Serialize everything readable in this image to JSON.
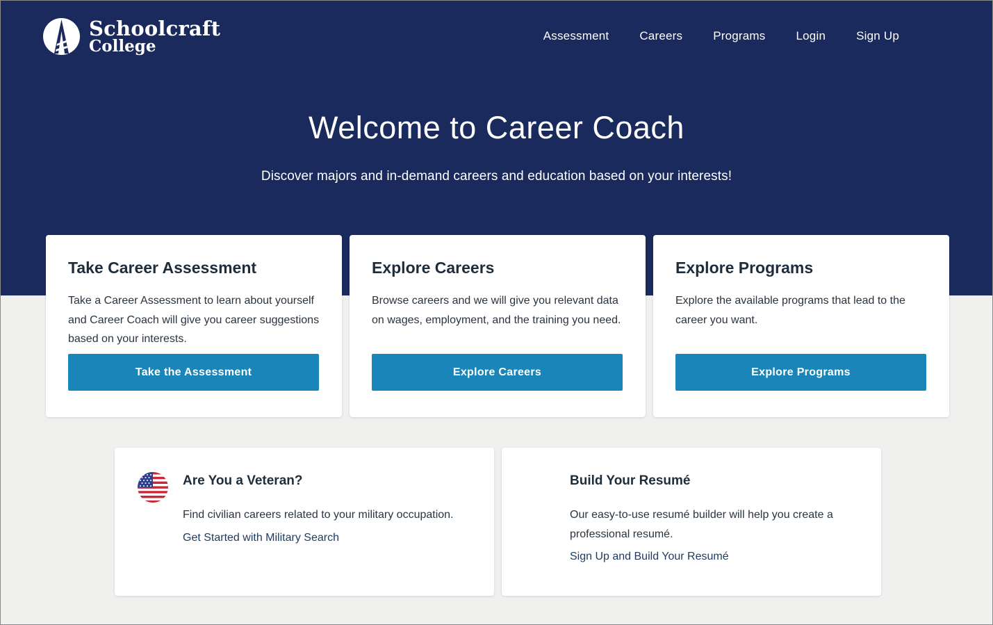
{
  "header": {
    "logo_line1": "Schoolcraft",
    "logo_line2": "College",
    "nav": [
      "Assessment",
      "Careers",
      "Programs",
      "Login",
      "Sign Up"
    ]
  },
  "hero": {
    "title": "Welcome to Career Coach",
    "subtitle": "Discover majors and in-demand careers and education based on your interests!"
  },
  "cards": [
    {
      "title": "Take Career Assessment",
      "text": "Take a Career Assessment to learn about yourself and Career Coach will give you career suggestions based on your interests.",
      "button": "Take the Assessment"
    },
    {
      "title": "Explore Careers",
      "text": "Browse careers and we will give you relevant data on wages, employment, and the training you need.",
      "button": "Explore Careers"
    },
    {
      "title": "Explore Programs",
      "text": "Explore the available programs that lead to the career you want.",
      "button": "Explore Programs"
    }
  ],
  "veteran": {
    "title": "Are You a Veteran?",
    "text": "Find civilian careers related to your military occupation.",
    "link": "Get Started with Military Search"
  },
  "resume": {
    "title": "Build Your Resumé",
    "text": "Our easy-to-use resumé builder will help you create a professional resumé.",
    "link": "Sign Up and Build Your Resumé"
  },
  "colors": {
    "hero_bg": "#1a2a5c",
    "button_bg": "#1a85b8",
    "page_bg": "#f0f0ef"
  }
}
